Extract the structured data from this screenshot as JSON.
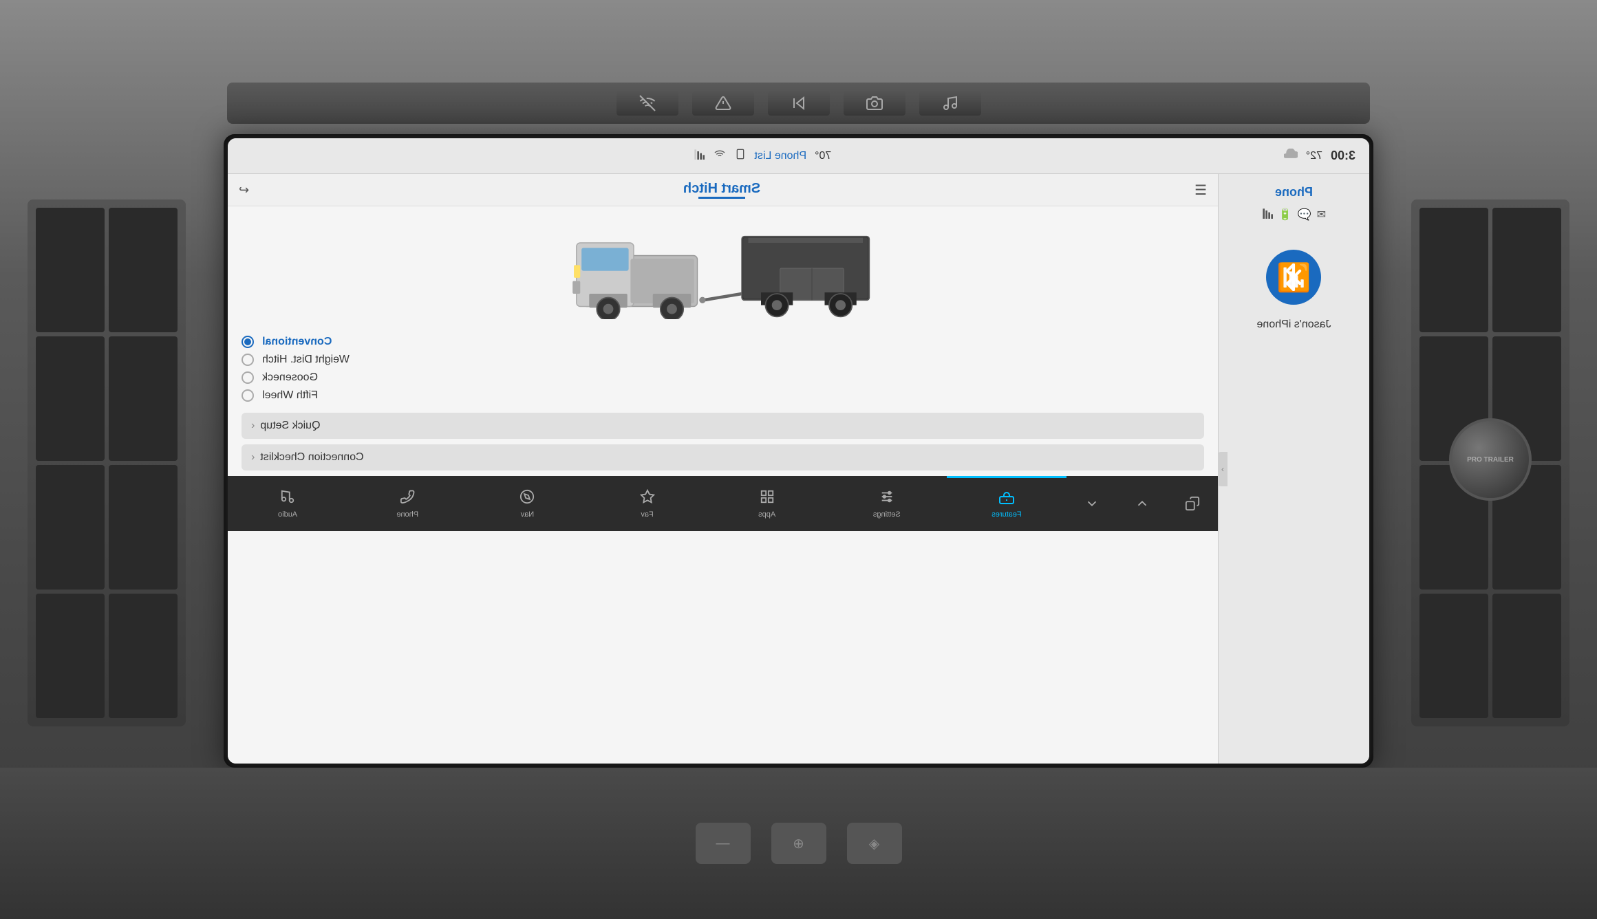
{
  "dashboard": {
    "background_color": "#5a5a5a"
  },
  "status_bar": {
    "time": "3:00",
    "temp_outside": "72°",
    "temp_cabin": "70°",
    "weather_icon": "cloud",
    "phone_list_label": "Phone List",
    "wifi_icon": "wifi",
    "signal_icon": "signal"
  },
  "left_panel": {
    "title": "Phone",
    "device_name": "Jason's iPhone",
    "bluetooth_label": "bluetooth"
  },
  "right_panel": {
    "title": "Smart Hitch",
    "hitch_options": [
      {
        "id": "conventional",
        "label": "Conventional",
        "selected": true
      },
      {
        "id": "weight-dist",
        "label": "Weight Dist. Hitch",
        "selected": false
      },
      {
        "id": "gooseneck",
        "label": "Gooseneck",
        "selected": false
      },
      {
        "id": "fifth-wheel",
        "label": "Fifth Wheel",
        "selected": false
      }
    ],
    "action_buttons": [
      {
        "id": "quick-setup",
        "label": "Quick Setup"
      },
      {
        "id": "connection-checklist",
        "label": "Connection Checklist"
      }
    ]
  },
  "bottom_nav": {
    "items": [
      {
        "id": "features",
        "label": "Features",
        "icon": "truck",
        "active": true
      },
      {
        "id": "settings",
        "label": "Settings",
        "icon": "sliders",
        "active": false
      },
      {
        "id": "apps",
        "label": "Apps",
        "icon": "grid",
        "active": false
      },
      {
        "id": "fav",
        "label": "Fav",
        "icon": "star",
        "active": false
      },
      {
        "id": "nav",
        "label": "Nav",
        "icon": "navigation",
        "active": false
      },
      {
        "id": "phone",
        "label": "Phone",
        "icon": "phone",
        "active": false
      },
      {
        "id": "audio",
        "label": "Audio",
        "icon": "music",
        "active": false
      }
    ]
  },
  "left_nav": {
    "buttons": [
      {
        "id": "copy",
        "icon": "copy"
      },
      {
        "id": "up",
        "icon": "chevron-up"
      },
      {
        "id": "down",
        "icon": "chevron-down"
      }
    ]
  },
  "trim_buttons": [
    {
      "id": "btn1",
      "icon": "phone-off"
    },
    {
      "id": "btn2",
      "icon": "alert-triangle"
    },
    {
      "id": "btn3",
      "icon": "skip-back"
    },
    {
      "id": "btn4",
      "icon": "camera"
    },
    {
      "id": "btn5",
      "icon": "music-2"
    }
  ],
  "right_knob": {
    "label": "PRO TRAILER"
  }
}
